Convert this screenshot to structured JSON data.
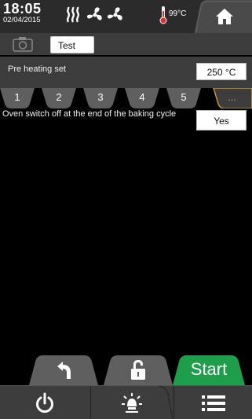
{
  "status": {
    "time": "18:05",
    "date": "02/04/2015",
    "temperature": "99°C",
    "icons": [
      "steam-icon",
      "fan-icon",
      "fan-icon",
      "thermometer-icon"
    ]
  },
  "program": {
    "name": "Test"
  },
  "preheat": {
    "label": "Pre heating set",
    "value": "250 °C"
  },
  "phases": {
    "tabs": [
      "1",
      "2",
      "3",
      "4",
      "5",
      "..."
    ],
    "active_index": 5
  },
  "switch_off": {
    "label": "Oven switch off at the end of the baking cycle",
    "value": "Yes"
  },
  "actions": {
    "start_label": "Start"
  },
  "colors": {
    "accent_green": "#1e9e4b",
    "tab_gray": "#5f5f5f",
    "active_tab_border": "#c8942e",
    "panel": "#3c3c3c"
  }
}
